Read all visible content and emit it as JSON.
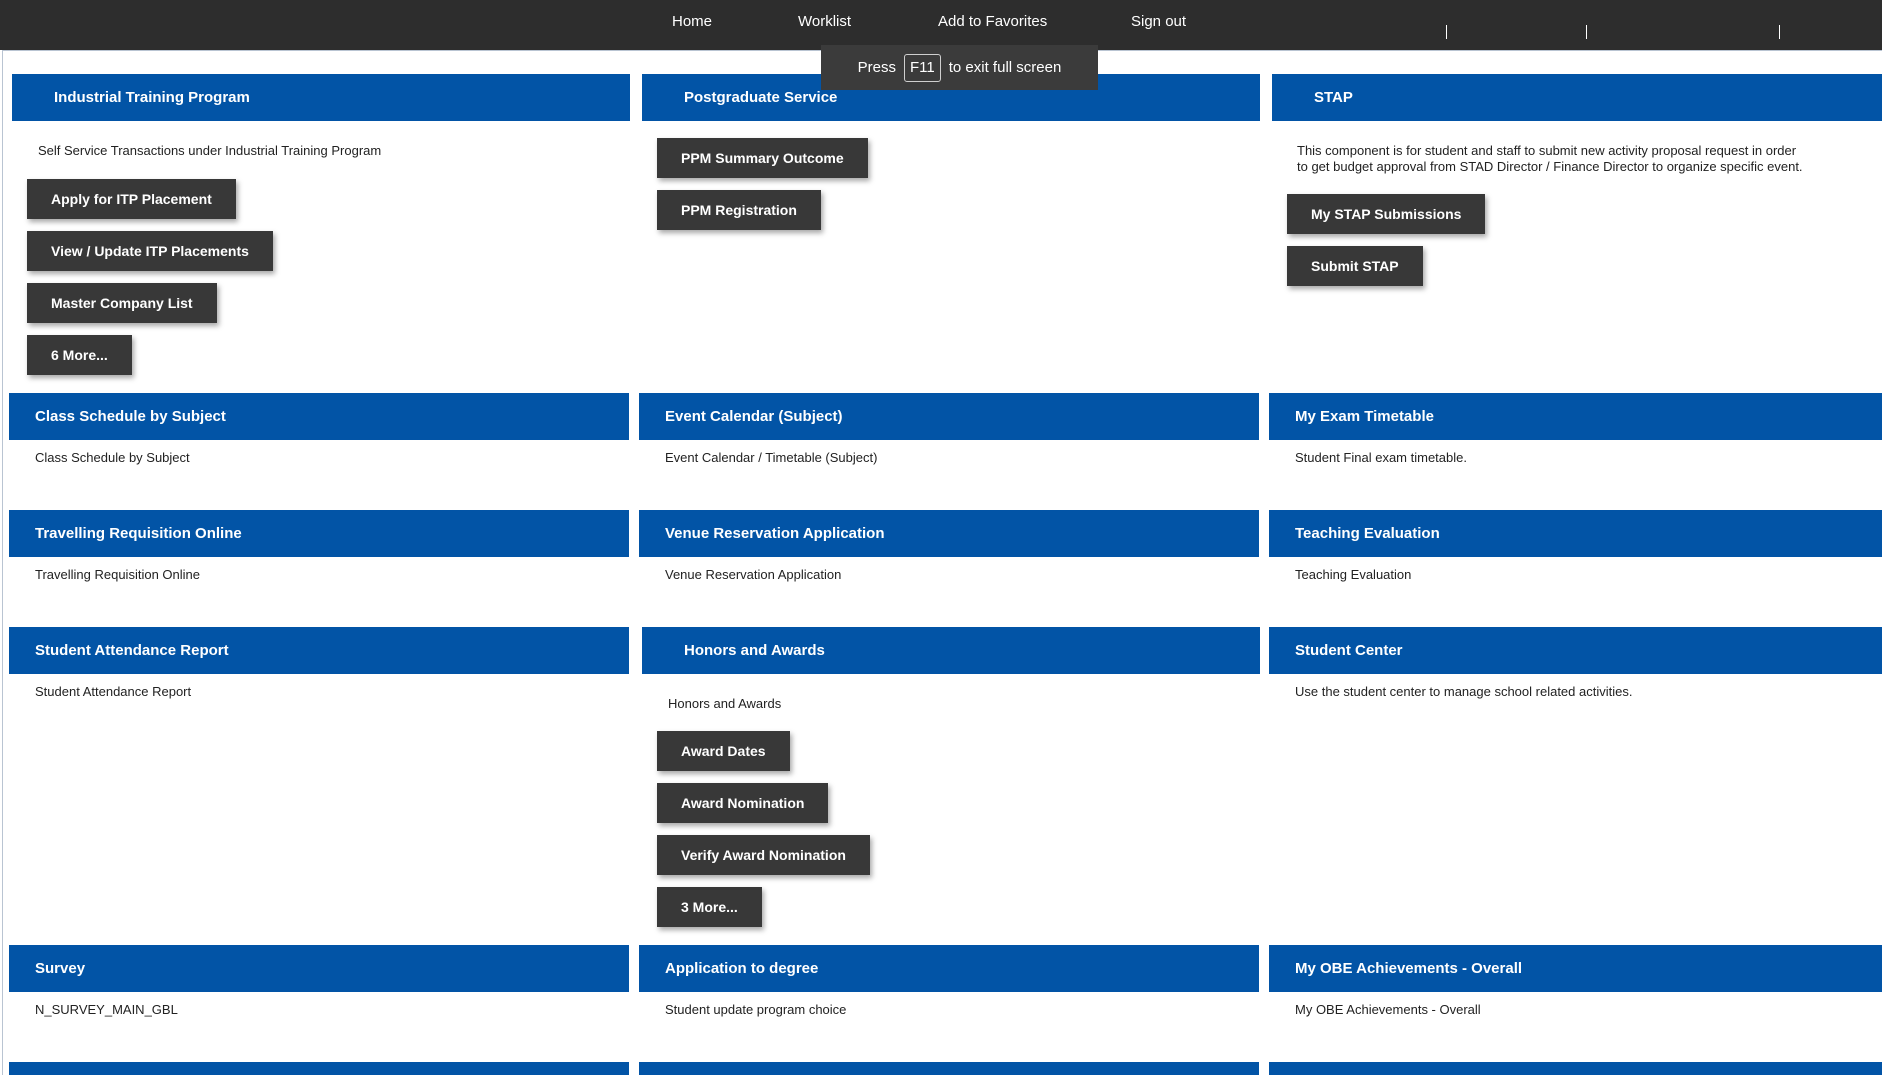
{
  "nav": {
    "home": "Home",
    "worklist": "Worklist",
    "add_to_favorites": "Add to Favorites",
    "sign_out": "Sign out"
  },
  "fullscreen_notice": {
    "press": "Press",
    "key": "F11",
    "message": "to exit full screen"
  },
  "tiles": {
    "itp": {
      "title": "Industrial Training Program",
      "description": "Self Service Transactions under Industrial Training Program",
      "buttons": [
        "Apply for ITP Placement",
        "View / Update ITP Placements",
        "Master Company List",
        "6 More..."
      ]
    },
    "postgrad": {
      "title": "Postgraduate Service",
      "buttons": [
        "PPM Summary Outcome",
        "PPM Registration"
      ]
    },
    "stap": {
      "title": "STAP",
      "description_line1": "This component is for student and staff to submit new activity proposal request in order",
      "description_line2": "to get budget approval from STAD Director / Finance Director to organize specific event.",
      "buttons": [
        "My STAP Submissions",
        "Submit STAP"
      ]
    },
    "class_schedule": {
      "title": "Class Schedule by Subject",
      "description": "Class Schedule by Subject"
    },
    "event_calendar": {
      "title": "Event Calendar (Subject)",
      "description": "Event Calendar / Timetable (Subject)"
    },
    "exam_timetable": {
      "title": "My Exam Timetable",
      "description": "Student Final exam timetable."
    },
    "travelling": {
      "title": "Travelling Requisition Online",
      "description": "Travelling Requisition Online"
    },
    "venue": {
      "title": "Venue Reservation Application",
      "description": "Venue Reservation Application"
    },
    "teaching_eval": {
      "title": "Teaching Evaluation",
      "description": "Teaching Evaluation"
    },
    "attendance": {
      "title": "Student Attendance Report",
      "description": "Student Attendance Report"
    },
    "honors": {
      "title": "Honors and Awards",
      "description": "Honors and Awards",
      "buttons": [
        "Award Dates",
        "Award Nomination",
        "Verify Award Nomination",
        "3 More..."
      ]
    },
    "student_center": {
      "title": "Student Center",
      "description": "Use the student center to manage school related activities."
    },
    "survey": {
      "title": "Survey",
      "description": "N_SURVEY_MAIN_GBL"
    },
    "app_degree": {
      "title": "Application to degree",
      "description": "Student update program choice"
    },
    "obe": {
      "title": "My OBE Achievements - Overall",
      "description": "My OBE Achievements - Overall"
    }
  },
  "colors": {
    "topbar": "#2d2d2d",
    "tile_header": "#0254a6",
    "button": "#383838"
  }
}
